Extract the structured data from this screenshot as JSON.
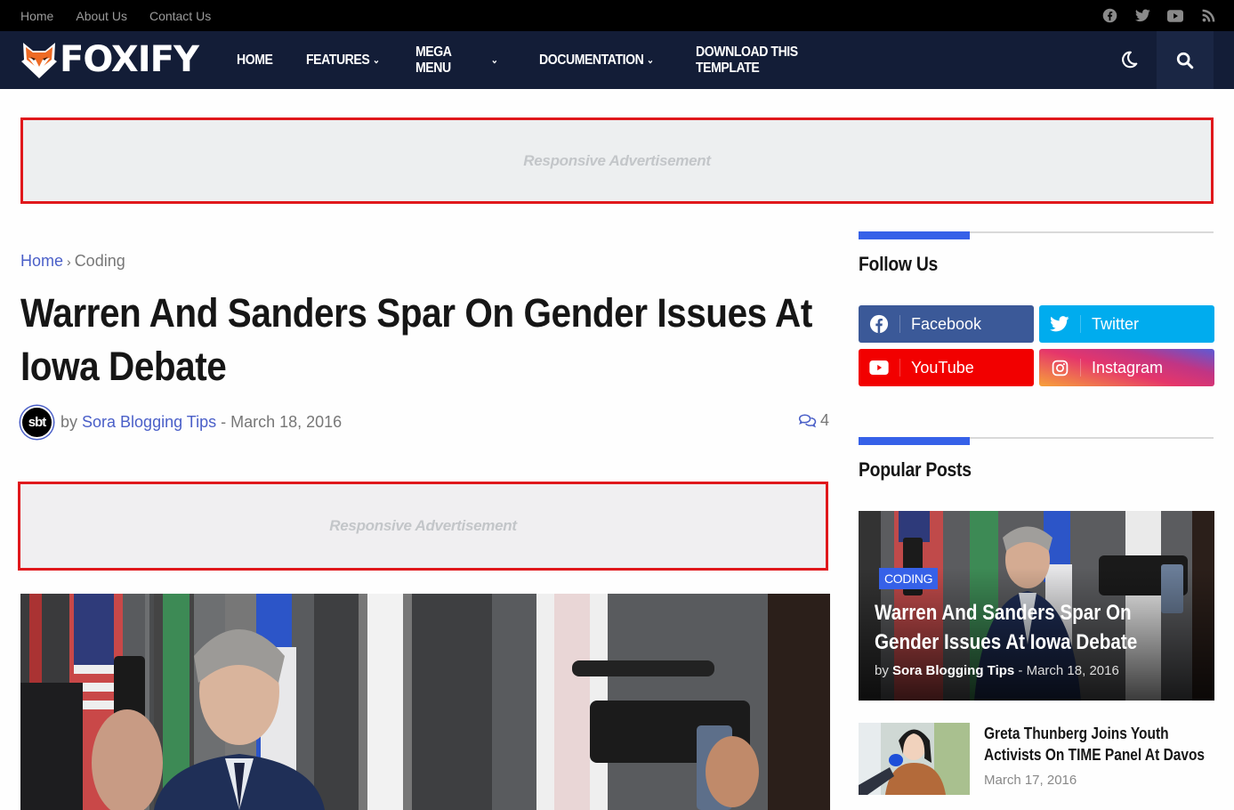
{
  "topbar": {
    "links": [
      "Home",
      "About Us",
      "Contact Us"
    ],
    "social_icons": [
      "facebook-icon",
      "twitter-icon",
      "youtube-icon",
      "rss-icon"
    ]
  },
  "header": {
    "logo_text": "FOXIFY",
    "menu": [
      {
        "label": "HOME",
        "dropdown": false
      },
      {
        "label": "FEATURES",
        "dropdown": true
      },
      {
        "label": "MEGA MENU",
        "dropdown": true
      },
      {
        "label": "DOCUMENTATION",
        "dropdown": true
      },
      {
        "label": "DOWNLOAD THIS TEMPLATE",
        "dropdown": false
      }
    ],
    "dark_mode_icon": "moon-icon",
    "search_icon": "search-icon"
  },
  "ads": {
    "top": "Responsive Advertisement",
    "middle": "Responsive Advertisement"
  },
  "post": {
    "breadcrumb": {
      "home": "Home",
      "separator": "›",
      "category": "Coding"
    },
    "title": "Warren And Sanders Spar On Gender Issues At Iowa Debate",
    "avatar_text": "sbt",
    "by": "by",
    "author": "Sora Blogging Tips",
    "date_sep": "-",
    "date": "March 18, 2016",
    "comment_count": "4"
  },
  "sidebar": {
    "follow_title": "Follow Us",
    "social_buttons": [
      {
        "label": "Facebook",
        "icon": "facebook-icon"
      },
      {
        "label": "Twitter",
        "icon": "twitter-icon"
      },
      {
        "label": "YouTube",
        "icon": "youtube-icon"
      },
      {
        "label": "Instagram",
        "icon": "instagram-icon"
      }
    ],
    "popular_title": "Popular Posts",
    "featured": {
      "category": "CODING",
      "title": "Warren And Sanders Spar On Gender Issues At Iowa Debate",
      "by": "by",
      "author": "Sora Blogging Tips",
      "date": "- March 18, 2016"
    },
    "posts": [
      {
        "title": "Greta Thunberg Joins Youth Activists On TIME Panel At Davos",
        "date": "March 17, 2016"
      }
    ]
  },
  "colors": {
    "nav_bg": "#131d37",
    "accent": "#3661e8",
    "link": "#4a5fc8",
    "ad_border": "#e0181c"
  }
}
